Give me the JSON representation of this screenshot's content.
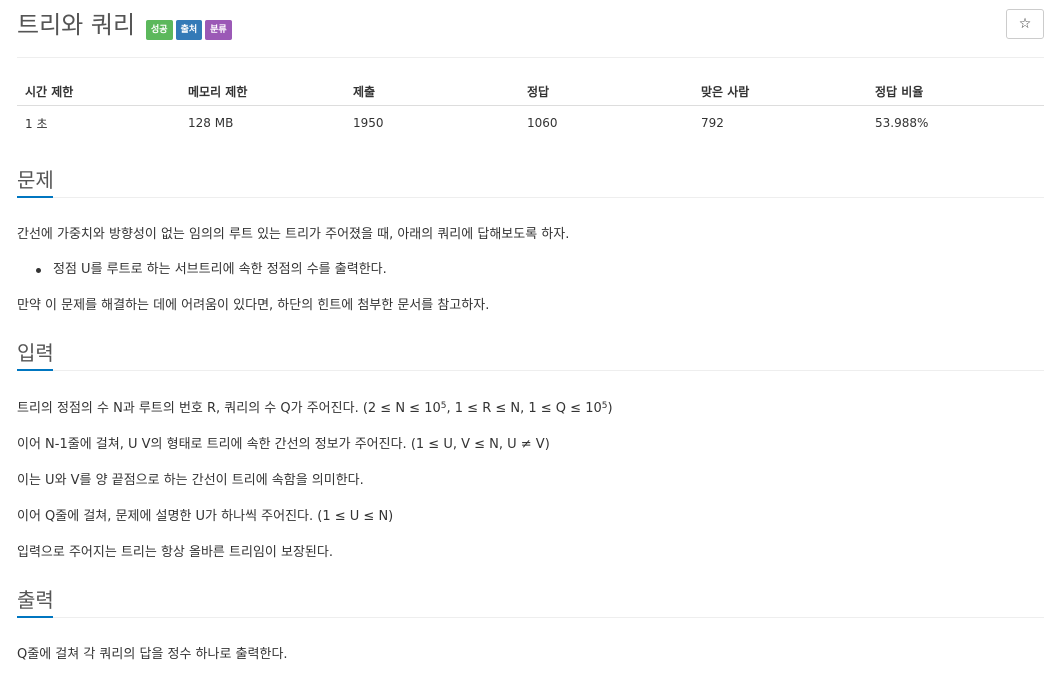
{
  "problem": {
    "title": "트리와 쿼리",
    "badges": [
      {
        "label": "성공",
        "color": "#5cb85c"
      },
      {
        "label": "출처",
        "color": "#337ab7"
      },
      {
        "label": "분류",
        "color": "#9b59b6"
      }
    ],
    "star_icon": "star-icon",
    "star_glyph": "☆"
  },
  "info_table": {
    "headers": [
      "시간 제한",
      "메모리 제한",
      "제출",
      "정답",
      "맞은 사람",
      "정답 비율"
    ],
    "values": [
      "1 초",
      "128 MB",
      "1950",
      "1060",
      "792",
      "53.988%"
    ]
  },
  "sections": {
    "problem": {
      "heading": "문제",
      "p1": "간선에 가중치와 방향성이 없는 임의의 루트 있는 트리가 주어졌을 때, 아래의 쿼리에 답해보도록 하자.",
      "bullet1": "정점 U를 루트로 하는 서브트리에 속한 정점의 수를 출력한다.",
      "p2": "만약 이 문제를 해결하는 데에 어려움이 있다면, 하단의 힌트에 첨부한 문서를 참고하자."
    },
    "input": {
      "heading": "입력",
      "l1_a": "트리의 정점의 수 N과 루트의 번호 R, 쿼리의 수 Q가 주어진다. (2 ≤ N ≤ 10",
      "l1_sup1": "5",
      "l1_b": ", 1 ≤ R ≤ N, 1 ≤ Q ≤ 10",
      "l1_sup2": "5",
      "l1_c": ")",
      "l2": "이어 N-1줄에 걸쳐, U V의 형태로 트리에 속한 간선의 정보가 주어진다. (1 ≤ U, V ≤ N, U ≠ V)",
      "l3": "이는 U와 V를 양 끝점으로 하는 간선이 트리에 속함을 의미한다.",
      "l4": "이어 Q줄에 걸쳐, 문제에 설명한 U가 하나씩 주어진다. (1 ≤ U ≤ N)",
      "l5": "입력으로 주어지는 트리는 항상 올바른 트리임이 보장된다."
    },
    "output": {
      "heading": "출력",
      "l1": "Q줄에 걸쳐 각 쿼리의 답을 정수 하나로 출력한다."
    }
  }
}
